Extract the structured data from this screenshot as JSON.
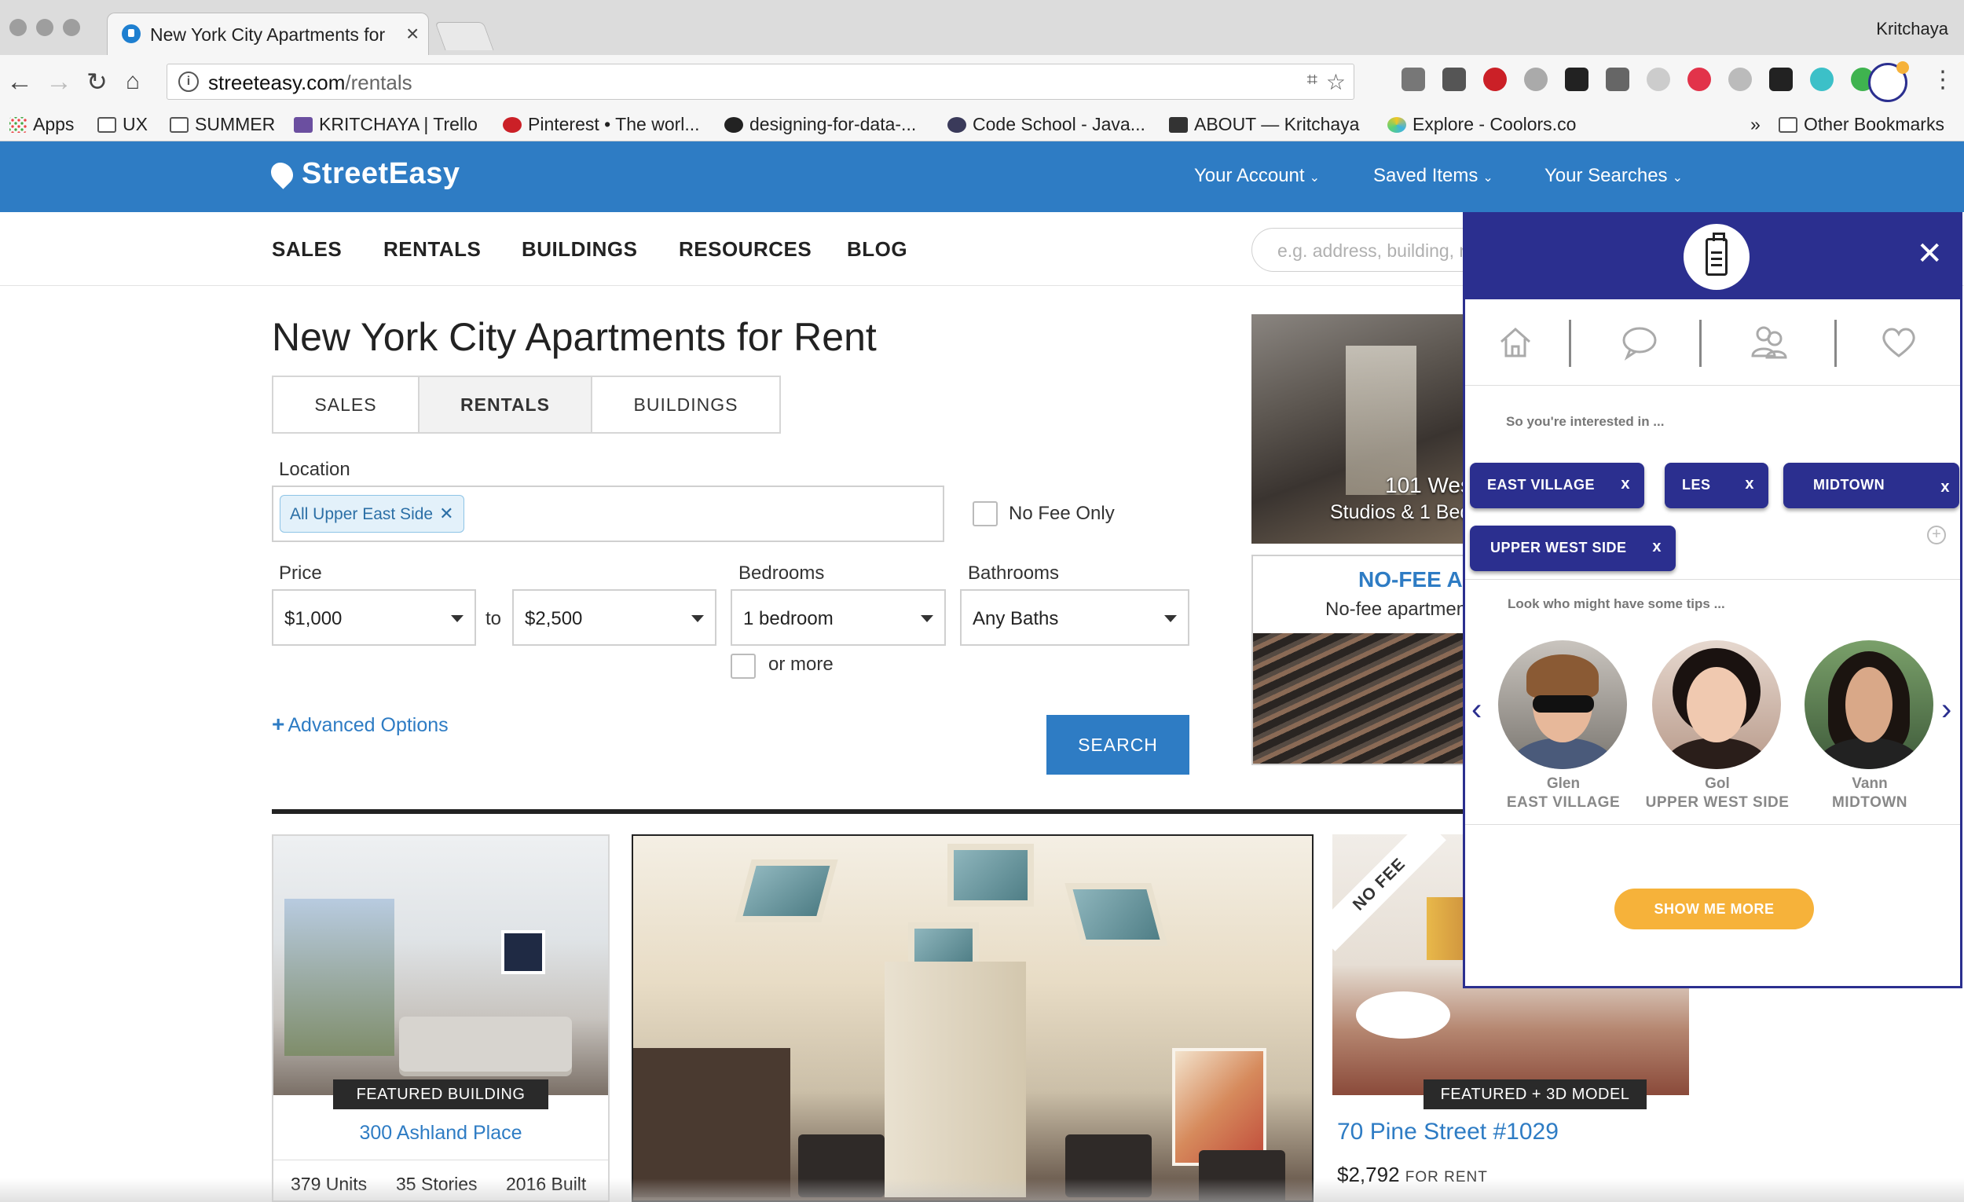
{
  "browser": {
    "tab_title": "New York City Apartments for",
    "profile_name": "Kritchaya",
    "url_host": "streeteasy.com",
    "url_path": "/rentals",
    "bookmarks": [
      {
        "label": "Apps",
        "icon": "apps-grid-icon"
      },
      {
        "label": "UX",
        "icon": "folder-icon"
      },
      {
        "label": "SUMMER",
        "icon": "folder-icon"
      },
      {
        "label": "KRITCHAYA | Trello",
        "icon": "trello-icon"
      },
      {
        "label": "Pinterest • The worl...",
        "icon": "pinterest-icon"
      },
      {
        "label": "designing-for-data-...",
        "icon": "github-icon"
      },
      {
        "label": "Code School - Java...",
        "icon": "codeschool-icon"
      },
      {
        "label": "ABOUT — Kritchaya",
        "icon": "cube-icon"
      },
      {
        "label": "Explore - Coolors.co",
        "icon": "coolors-icon"
      }
    ],
    "bookmarks_overflow": "»",
    "other_bookmarks": "Other Bookmarks"
  },
  "site": {
    "logo": "StreetEasy",
    "account_menu": [
      "Your Account",
      "Saved Items",
      "Your Searches"
    ],
    "nav": [
      "SALES",
      "RENTALS",
      "BUILDINGS",
      "RESOURCES",
      "BLOG"
    ],
    "search_placeholder": "e.g. address, building, n"
  },
  "search_form": {
    "title": "New York City Apartments for Rent",
    "tabs": [
      "SALES",
      "RENTALS",
      "BUILDINGS"
    ],
    "active_tab": "RENTALS",
    "location_label": "Location",
    "location_chip": "All Upper East Side",
    "no_fee_label": "No Fee Only",
    "price_label": "Price",
    "price_min": "$1,000",
    "price_to": "to",
    "price_max": "$2,500",
    "bedrooms_label": "Bedrooms",
    "bedrooms_value": "1 bedroom",
    "or_more_label": "or more",
    "bathrooms_label": "Bathrooms",
    "bathrooms_value": "Any Baths",
    "advanced_options": "Advanced Options",
    "search_button": "SEARCH"
  },
  "ads": {
    "ad1_title": "101 Wes",
    "ad1_subtitle": "Studios & 1 Bed",
    "ad2_title": "NO-FEE AP",
    "ad2_subtitle": "No-fee apartmen"
  },
  "listings": [
    {
      "badge": "FEATURED BUILDING",
      "name": "300 Ashland Place",
      "stats": [
        "379 Units",
        "35 Stories",
        "2016 Built"
      ]
    },
    {
      "badge": "FEATURED + 3D MODEL",
      "ribbon": "NO FEE",
      "name": "70 Pine Street #1029",
      "price": "$2,792",
      "price_unit": "FOR RENT"
    }
  ],
  "extension": {
    "colors": {
      "primary": "#2b2f8f",
      "accent": "#f6b23a"
    },
    "interested_label": "So you're interested in ...",
    "neighborhoods": [
      "EAST VILLAGE",
      "LES",
      "MIDTOWN",
      "UPPER WEST SIDE"
    ],
    "chip_remove": "x",
    "tips_label": "Look who might have some tips ...",
    "people": [
      {
        "name": "Glen",
        "area": "EAST VILLAGE"
      },
      {
        "name": "Gol",
        "area": "UPPER WEST SIDE"
      },
      {
        "name": "Vann",
        "area": "MIDTOWN"
      }
    ],
    "show_more": "SHOW ME MORE"
  }
}
